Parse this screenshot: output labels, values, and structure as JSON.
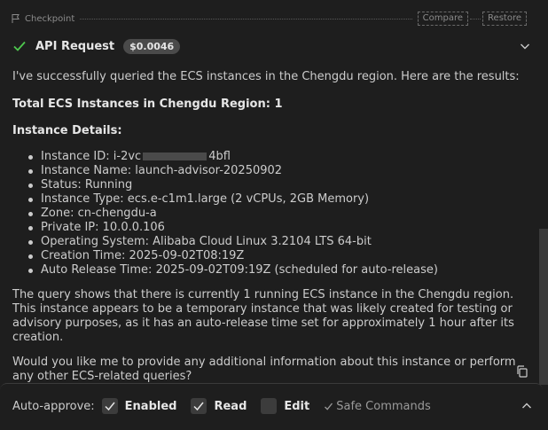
{
  "checkpoint": {
    "label": "Checkpoint",
    "compare_label": "Compare",
    "restore_label": "Restore"
  },
  "api_request": {
    "title": "API Request",
    "cost": "$0.0046",
    "status_color": "#4ec94e"
  },
  "message": {
    "intro": "I've successfully queried the ECS instances in the Chengdu region. Here are the results:",
    "total": "Total ECS Instances in Chengdu Region: 1",
    "details_heading": "Instance Details:",
    "instance_id_prefix": "Instance ID: i-2vc",
    "instance_id_suffix": "4bfl",
    "details": [
      "Instance Name: launch-advisor-20250902",
      "Status: Running",
      "Instance Type: ecs.e-c1m1.large (2 vCPUs, 2GB Memory)",
      "Zone: cn-chengdu-a",
      "Private IP: 10.0.0.106",
      "Operating System: Alibaba Cloud Linux 3.2104 LTS 64-bit",
      "Creation Time: 2025-09-02T08:19Z",
      "Auto Release Time: 2025-09-02T09:19Z (scheduled for auto-release)"
    ],
    "summary": "The query shows that there is currently 1 running ECS instance in the Chengdu region. This instance appears to be a temporary instance that was likely created for testing or advisory purposes, as it has an auto-release time set for approximately 1 hour after its creation.",
    "followup": "Would you like me to provide any additional information about this instance or perform any other ECS-related queries?"
  },
  "auto_approve": {
    "label": "Auto-approve:",
    "enabled_label": "Enabled",
    "enabled_checked": true,
    "read_label": "Read",
    "read_checked": true,
    "edit_label": "Edit",
    "edit_checked": false,
    "safe_commands_label": "Safe Commands",
    "safe_commands_checked": true
  },
  "icons": {
    "checkpoint": "flag-icon",
    "status": "check-icon",
    "expand": "chevron-down-icon",
    "copy": "copy-icon",
    "collapse": "chevron-up-icon"
  }
}
